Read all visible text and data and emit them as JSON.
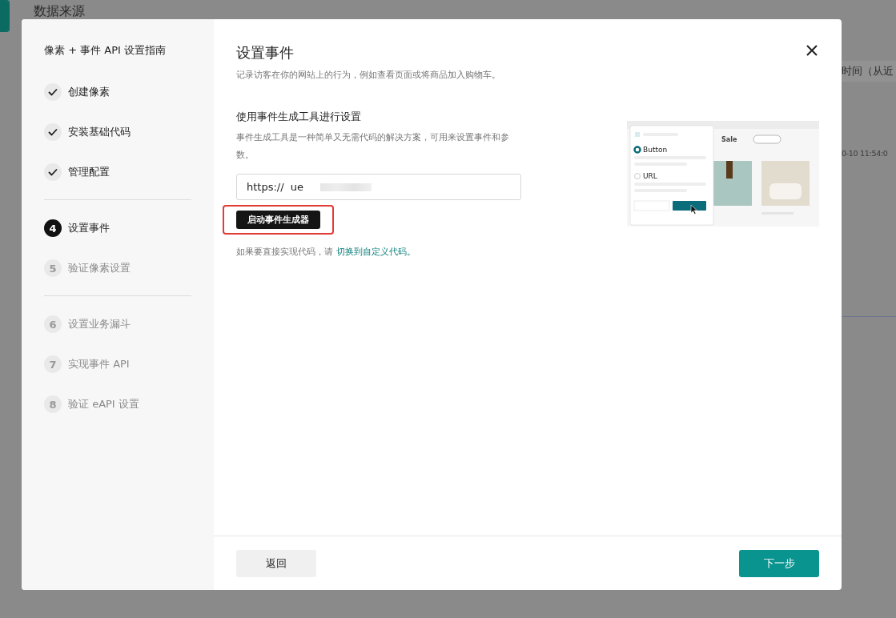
{
  "background": {
    "title": "数据来源",
    "column_header": "时间（从近",
    "cell": "0-10 11:54:0"
  },
  "dialog": {
    "guide_title": "像素 + 事件 API 设置指南",
    "step_groups": [
      [
        {
          "label": "创建像素",
          "done": true,
          "current": false
        },
        {
          "label": "安装基础代码",
          "done": true,
          "current": false
        },
        {
          "label": "管理配置",
          "done": true,
          "current": false
        }
      ],
      [
        {
          "number": "4",
          "label": "设置事件",
          "done": false,
          "current": true
        },
        {
          "number": "5",
          "label": "验证像素设置",
          "done": false,
          "current": false
        }
      ],
      [
        {
          "number": "6",
          "label": "设置业务漏斗",
          "done": false,
          "current": false
        },
        {
          "number": "7",
          "label": "实现事件 API",
          "done": false,
          "current": false
        },
        {
          "number": "8",
          "label": "验证 eAPI 设置",
          "done": false,
          "current": false
        }
      ]
    ],
    "title": "设置事件",
    "subtitle": "记录访客在你的网站上的行为，例如查看页面或将商品加入购物车。",
    "section_title": "使用事件生成工具进行设置",
    "section_description": "事件生成工具是一种简单又无需代码的解决方案，可用来设置事件和参数。",
    "url_value": "https://  ue",
    "launch_button": "启动事件生成器",
    "hint_text": "如果要直接实现代码，请 ",
    "hint_link": "切换到自定义代码。",
    "illustration": {
      "nav_item": "Sale",
      "options": [
        {
          "label": "Button",
          "selected": true
        },
        {
          "label": "URL",
          "selected": false
        }
      ]
    },
    "back_button": "返回",
    "next_button": "下一步"
  }
}
